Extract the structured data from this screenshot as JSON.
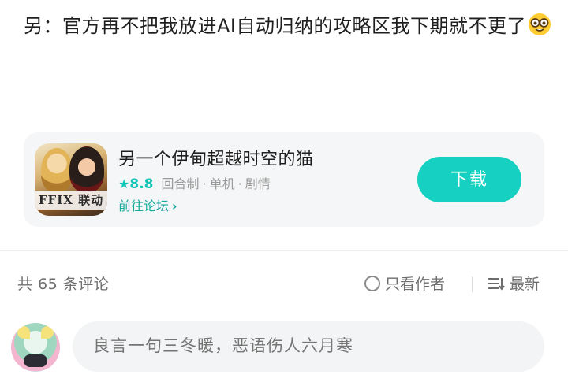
{
  "post": {
    "text": "另：官方再不把我放进AI自动归纳的攻略区我下期就不更了",
    "emoji": "nerd-face-emoji"
  },
  "game_card": {
    "title": "另一个伊甸超越时空的猫",
    "rating": "8.8",
    "tags": [
      "回合制",
      "单机",
      "剧情"
    ],
    "forum_link": "前往论坛",
    "download_label": "下载",
    "icon_badge": "FFIX 联动",
    "accent_color": "#16d1c1"
  },
  "comments": {
    "count_label": "共 65 条评论",
    "author_only_label": "只看作者",
    "sort_label": "最新"
  },
  "comment_input": {
    "placeholder": "良言一句三冬暖，恶语伤人六月寒"
  }
}
